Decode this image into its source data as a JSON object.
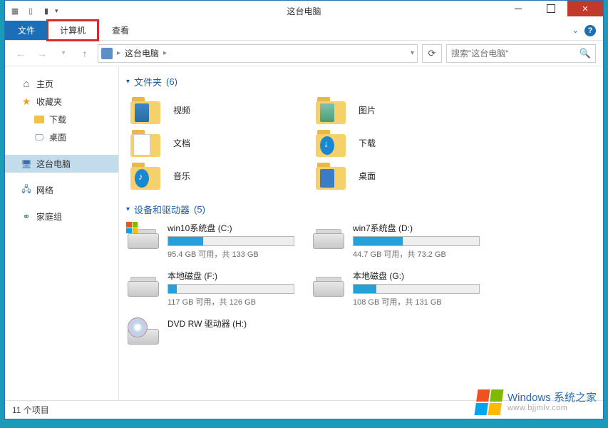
{
  "window": {
    "title": "这台电脑"
  },
  "ribbon": {
    "tabs": {
      "file": "文件",
      "computer": "计算机",
      "view": "查看"
    }
  },
  "breadcrumb": {
    "location": "这台电脑",
    "sep": "▶"
  },
  "search": {
    "placeholder": "搜索\"这台电脑\""
  },
  "sidebar": {
    "home": "主页",
    "favorites": "收藏夹",
    "downloads": "下载",
    "desktop": "桌面",
    "this_pc": "这台电脑",
    "network": "网络",
    "homegroup": "家庭组"
  },
  "groups": {
    "folders": {
      "label": "文件夹",
      "count": "(6)"
    },
    "devices": {
      "label": "设备和驱动器",
      "count": "(5)"
    }
  },
  "folders": {
    "video": "视频",
    "pictures": "图片",
    "documents": "文档",
    "downloads": "下载",
    "music": "音乐",
    "desktop": "桌面"
  },
  "drives": [
    {
      "name": "win10系统盘 (C:)",
      "free": "95.4 GB 可用，共 133 GB",
      "fill": 28,
      "winlogo": true
    },
    {
      "name": "win7系统盘 (D:)",
      "free": "44.7 GB 可用，共 73.2 GB",
      "fill": 39,
      "winlogo": false
    },
    {
      "name": "本地磁盘 (F:)",
      "free": "117 GB 可用，共 126 GB",
      "fill": 7,
      "winlogo": false
    },
    {
      "name": "本地磁盘 (G:)",
      "free": "108 GB 可用，共 131 GB",
      "fill": 18,
      "winlogo": false
    }
  ],
  "optical": {
    "name": "DVD RW 驱动器 (H:)"
  },
  "status": {
    "items": "11 个项目"
  },
  "watermark": {
    "brand": "Windows",
    "site": "系统之家",
    "url": "www.bjjmlv.com"
  }
}
